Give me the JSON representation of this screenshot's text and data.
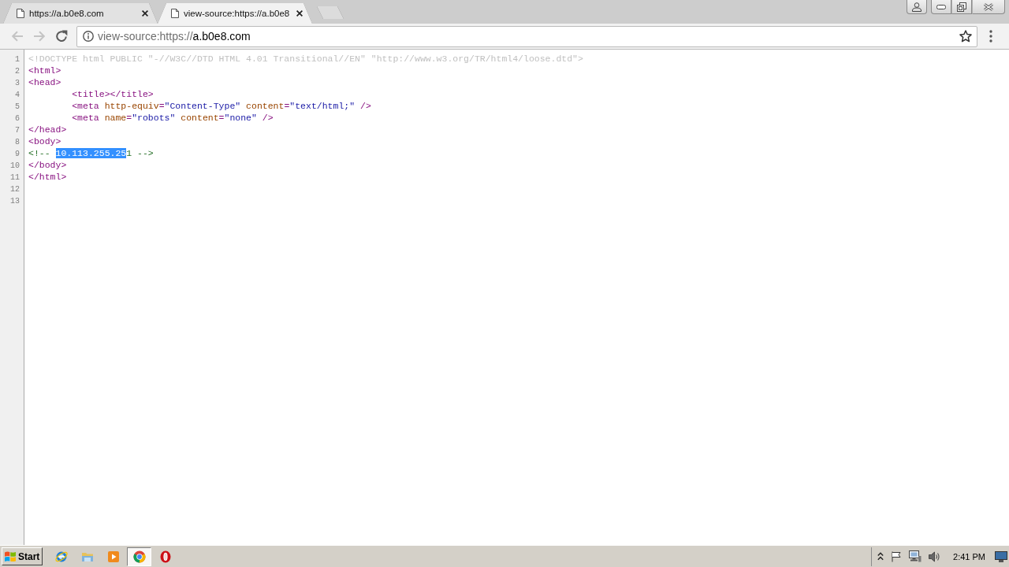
{
  "tabs": [
    {
      "title": "https://a.b0e8.com",
      "selected": false
    },
    {
      "title": "view-source:https://a.b0e8",
      "selected": true
    }
  ],
  "toolbar": {
    "buttons": [
      {
        "kind": "back",
        "disabled": true
      },
      {
        "kind": "forward",
        "disabled": true
      },
      {
        "kind": "reload",
        "disabled": false
      }
    ],
    "address": {
      "scheme": "view-source:https://",
      "host": "a.b0e8.com"
    }
  },
  "source": {
    "lines": [
      {
        "number": "1",
        "tokens": [
          {
            "kind": "doctype",
            "text": "<!DOCTYPE html PUBLIC \"-//W3C//DTD HTML 4.01 Transitional//EN\" \"http://www.w3.org/TR/html4/loose.dtd\">",
            "selected": false
          }
        ]
      },
      {
        "number": "2",
        "tokens": [
          {
            "kind": "tag",
            "text": "<html>",
            "selected": false
          }
        ]
      },
      {
        "number": "3",
        "tokens": [
          {
            "kind": "tag",
            "text": "<head>",
            "selected": false
          }
        ]
      },
      {
        "number": "4",
        "tokens": [
          {
            "kind": "tag",
            "text": "\t<title></title>",
            "selected": false
          }
        ]
      },
      {
        "number": "5",
        "tokens": [
          {
            "kind": "tag",
            "text": "\t<meta",
            "selected": false
          },
          {
            "kind": "attr",
            "text": " http-equiv",
            "selected": false
          },
          {
            "kind": "tag",
            "text": "=",
            "selected": false
          },
          {
            "kind": "value",
            "text": "\"Content-Type\"",
            "selected": false
          },
          {
            "kind": "attr",
            "text": " content",
            "selected": false
          },
          {
            "kind": "tag",
            "text": "=",
            "selected": false
          },
          {
            "kind": "value",
            "text": "\"text/html;\"",
            "selected": false
          },
          {
            "kind": "tag",
            "text": " />",
            "selected": false
          }
        ]
      },
      {
        "number": "6",
        "tokens": [
          {
            "kind": "tag",
            "text": "\t<meta",
            "selected": false
          },
          {
            "kind": "attr",
            "text": " name",
            "selected": false
          },
          {
            "kind": "tag",
            "text": "=",
            "selected": false
          },
          {
            "kind": "value",
            "text": "\"robots\"",
            "selected": false
          },
          {
            "kind": "attr",
            "text": " content",
            "selected": false
          },
          {
            "kind": "tag",
            "text": "=",
            "selected": false
          },
          {
            "kind": "value",
            "text": "\"none\"",
            "selected": false
          },
          {
            "kind": "tag",
            "text": " />",
            "selected": false
          }
        ]
      },
      {
        "number": "7",
        "tokens": [
          {
            "kind": "tag",
            "text": "</head>",
            "selected": false
          }
        ]
      },
      {
        "number": "8",
        "tokens": [
          {
            "kind": "tag",
            "text": "<body>",
            "selected": false
          }
        ]
      },
      {
        "number": "9",
        "tokens": [
          {
            "kind": "comment",
            "text": "<!-- ",
            "selected": false
          },
          {
            "kind": "comment",
            "text": "10.113.255.25",
            "selected": true
          },
          {
            "kind": "comment",
            "text": "1 -->",
            "selected": false
          }
        ]
      },
      {
        "number": "10",
        "tokens": [
          {
            "kind": "tag",
            "text": "</body>",
            "selected": false
          }
        ]
      },
      {
        "number": "11",
        "tokens": [
          {
            "kind": "tag",
            "text": "</html>",
            "selected": false
          }
        ]
      },
      {
        "number": "12"
      },
      {
        "number": "13"
      }
    ]
  },
  "taskbar": {
    "start": "Start",
    "apps": [
      {
        "kind": "ie",
        "selected": false
      },
      {
        "kind": "explorer",
        "selected": false
      },
      {
        "kind": "media",
        "selected": false
      },
      {
        "kind": "chrome",
        "selected": true
      },
      {
        "kind": "opera",
        "selected": false
      }
    ],
    "clock": "2:41 PM"
  }
}
